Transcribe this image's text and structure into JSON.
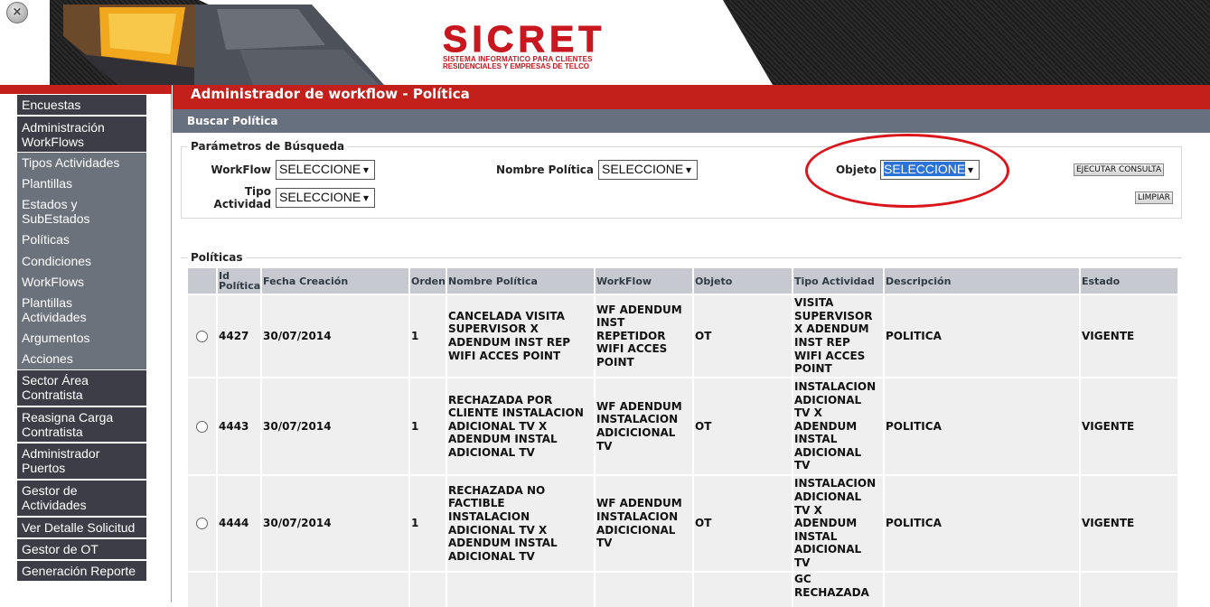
{
  "header": {
    "close_glyph": "×",
    "logo_title": "SICRET",
    "logo_subtitle_line1": "SISTEMA INFORMATICO PARA CLIENTES",
    "logo_subtitle_line2": "RESIDENCIALES Y EMPRESAS DE TELCO"
  },
  "sidebar": {
    "items": [
      {
        "line1": "Encuestas",
        "line2": ""
      },
      {
        "line1": "Administración",
        "line2": "WorkFlows"
      },
      {
        "line1": "Tipos Actividades",
        "line2": ""
      },
      {
        "line1": "Plantillas",
        "line2": ""
      },
      {
        "line1": "Estados y",
        "line2": "SubEstados"
      },
      {
        "line1": "Políticas",
        "line2": ""
      },
      {
        "line1": "Condiciones",
        "line2": ""
      },
      {
        "line1": "WorkFlows",
        "line2": ""
      },
      {
        "line1": "Plantillas",
        "line2": "Actividades"
      },
      {
        "line1": "Argumentos",
        "line2": ""
      },
      {
        "line1": "Acciones",
        "line2": ""
      },
      {
        "line1": "Sector Área",
        "line2": "Contratista"
      },
      {
        "line1": "Reasigna Carga",
        "line2": "Contratista"
      },
      {
        "line1": "Administrador",
        "line2": "Puertos"
      },
      {
        "line1": "Gestor de",
        "line2": "Actividades"
      },
      {
        "line1": "Ver Detalle Solicitud",
        "line2": ""
      },
      {
        "line1": "Gestor de OT",
        "line2": ""
      },
      {
        "line1": "Generación Reporte",
        "line2": ""
      }
    ]
  },
  "main": {
    "title": "Administrador de workflow - Política",
    "subtitle": "Buscar Política"
  },
  "search": {
    "legend": "Parámetros de Búsqueda",
    "workflow_label": "WorkFlow",
    "workflow_value": "SELECCIONE",
    "tipo_label_line1": "Tipo",
    "tipo_label_line2": "Actividad",
    "tipo_value": "SELECCIONE",
    "nombre_label": "Nombre Política",
    "nombre_value": "SELECCIONE",
    "objeto_label": "Objeto",
    "objeto_value": "SELECCIONE",
    "dropdown_glyph": "▾",
    "execute_button": "EJECUTAR CONSULTA",
    "clear_button": "LIMPIAR"
  },
  "results": {
    "legend": "Políticas",
    "columns": {
      "id_line1": "Id",
      "id_line2": "Política",
      "fecha": "Fecha Creación",
      "orden": "Orden",
      "nombre": "Nombre Política",
      "workflow": "WorkFlow",
      "objeto": "Objeto",
      "tipo": "Tipo Actividad",
      "descripcion": "Descripción",
      "estado": "Estado"
    },
    "rows": [
      {
        "id": "4427",
        "fecha": "30/07/2014",
        "orden": "1",
        "nombre": [
          "CANCELADA VISITA",
          "SUPERVISOR X",
          "ADENDUM INST REP",
          "WIFI ACCES POINT"
        ],
        "workflow": [
          "WF ADENDUM",
          "INST",
          "REPETIDOR",
          "WIFI ACCES",
          "POINT"
        ],
        "objeto": "OT",
        "tipo": [
          "VISITA",
          "SUPERVISOR",
          "X ADENDUM",
          "INST REP",
          "WIFI ACCES",
          "POINT"
        ],
        "descripcion": "POLITICA",
        "estado": "VIGENTE"
      },
      {
        "id": "4443",
        "fecha": "30/07/2014",
        "orden": "1",
        "nombre": [
          "RECHAZADA POR",
          "CLIENTE INSTALACION",
          "ADICIONAL TV X",
          "ADENDUM INSTAL",
          "ADICIONAL TV"
        ],
        "workflow": [
          "WF ADENDUM",
          "INSTALACION",
          "ADICICIONAL",
          "TV"
        ],
        "objeto": "OT",
        "tipo": [
          "INSTALACION",
          "ADICIONAL",
          "TV X",
          "ADENDUM",
          "INSTAL",
          "ADICIONAL",
          "TV"
        ],
        "descripcion": "POLITICA",
        "estado": "VIGENTE"
      },
      {
        "id": "4444",
        "fecha": "30/07/2014",
        "orden": "1",
        "nombre": [
          "RECHAZADA NO",
          "FACTIBLE",
          "INSTALACION",
          "ADICIONAL TV X",
          "ADENDUM INSTAL",
          "ADICIONAL TV"
        ],
        "workflow": [
          "WF ADENDUM",
          "INSTALACION",
          "ADICICIONAL",
          "TV"
        ],
        "objeto": "OT",
        "tipo": [
          "INSTALACION",
          "ADICIONAL",
          "TV X",
          "ADENDUM",
          "INSTAL",
          "ADICIONAL",
          "TV"
        ],
        "descripcion": "POLITICA",
        "estado": "VIGENTE"
      },
      {
        "id": "",
        "fecha": "",
        "orden": "",
        "nombre": [],
        "workflow": [],
        "objeto": "",
        "tipo": [
          "GC",
          "RECHAZADA"
        ],
        "descripcion": "",
        "estado": ""
      }
    ]
  }
}
